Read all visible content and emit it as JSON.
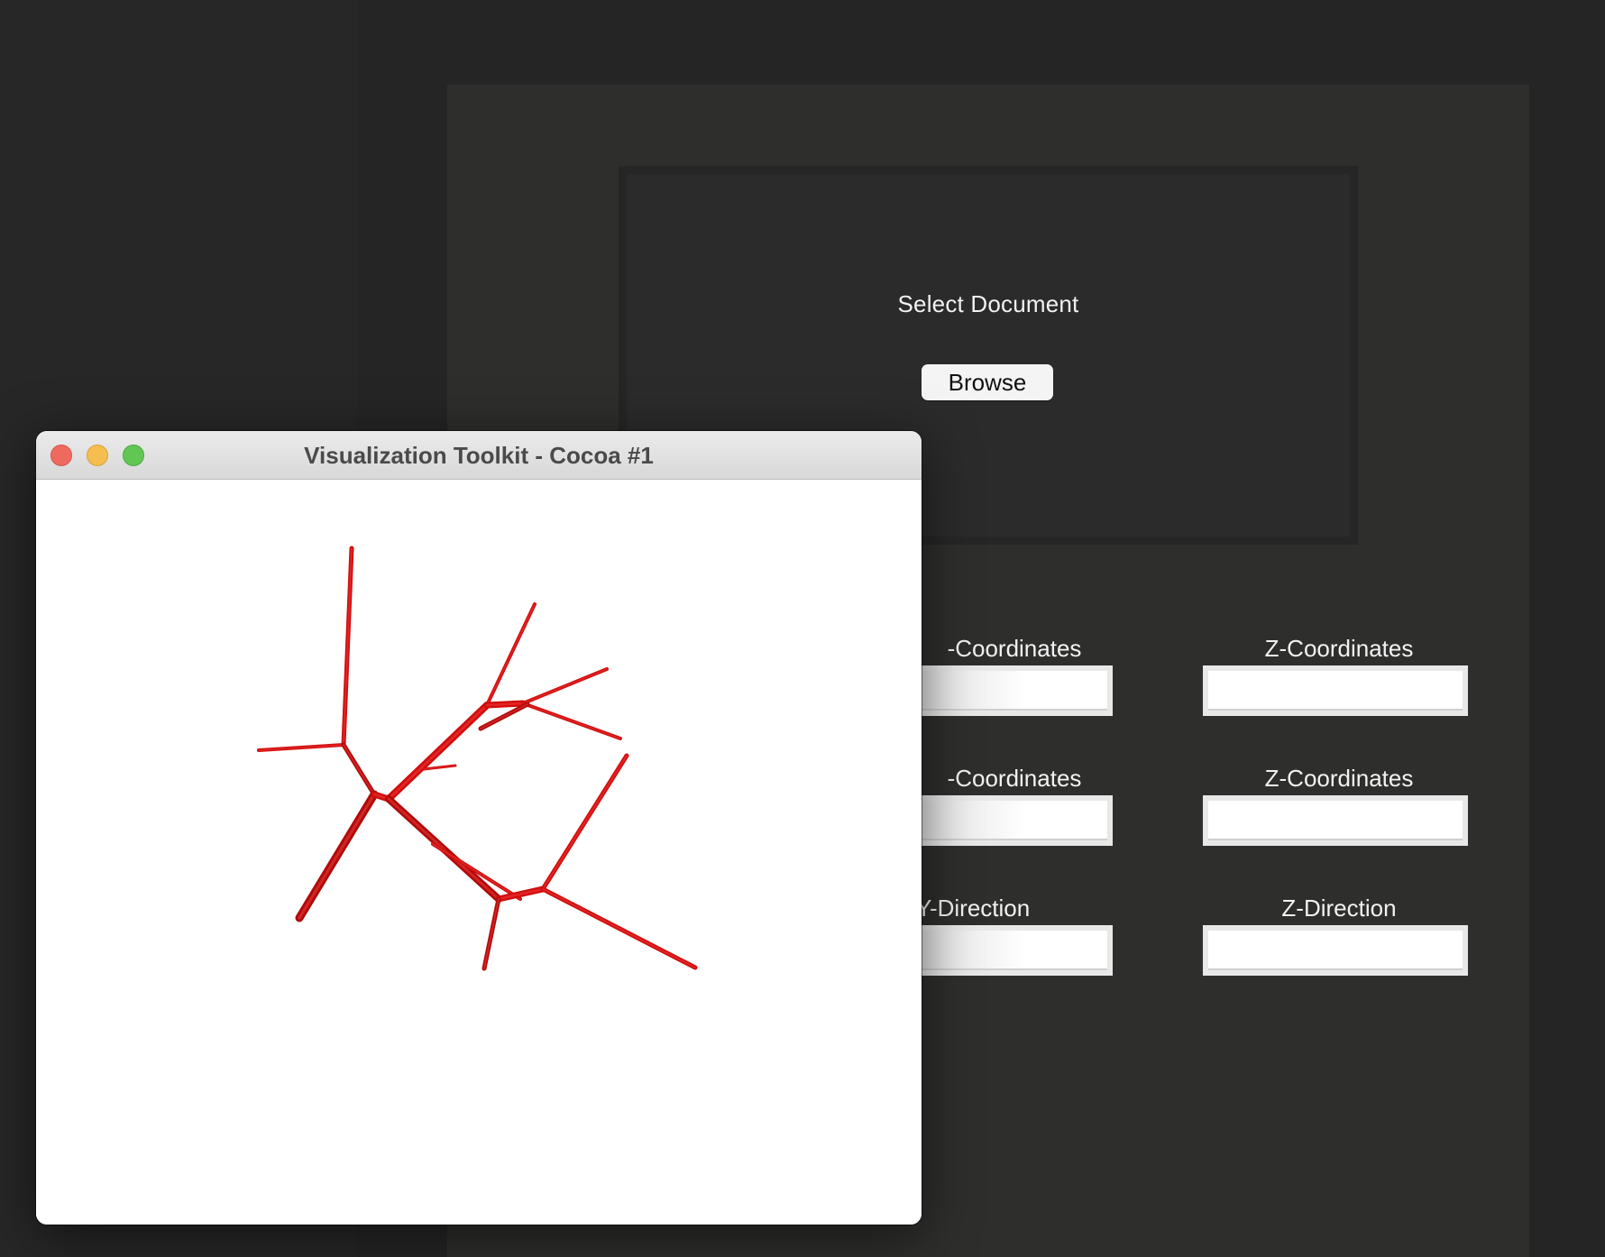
{
  "main_window": {
    "select_title": "Select Document",
    "browse_label": "Browse",
    "fields": [
      {
        "label": "-Coordinates",
        "value": ""
      },
      {
        "label": "Z-Coordinates",
        "value": ""
      },
      {
        "label": "-Coordinates",
        "value": ""
      },
      {
        "label": "Z-Coordinates",
        "value": ""
      },
      {
        "label": "Y-Direction",
        "value": ""
      },
      {
        "label": "Z-Direction",
        "value": ""
      }
    ]
  },
  "vtk_window": {
    "title": "Visualization Toolkit - Cocoa #1",
    "render_color": "#d10d0d",
    "background_color": "#ffffff"
  }
}
